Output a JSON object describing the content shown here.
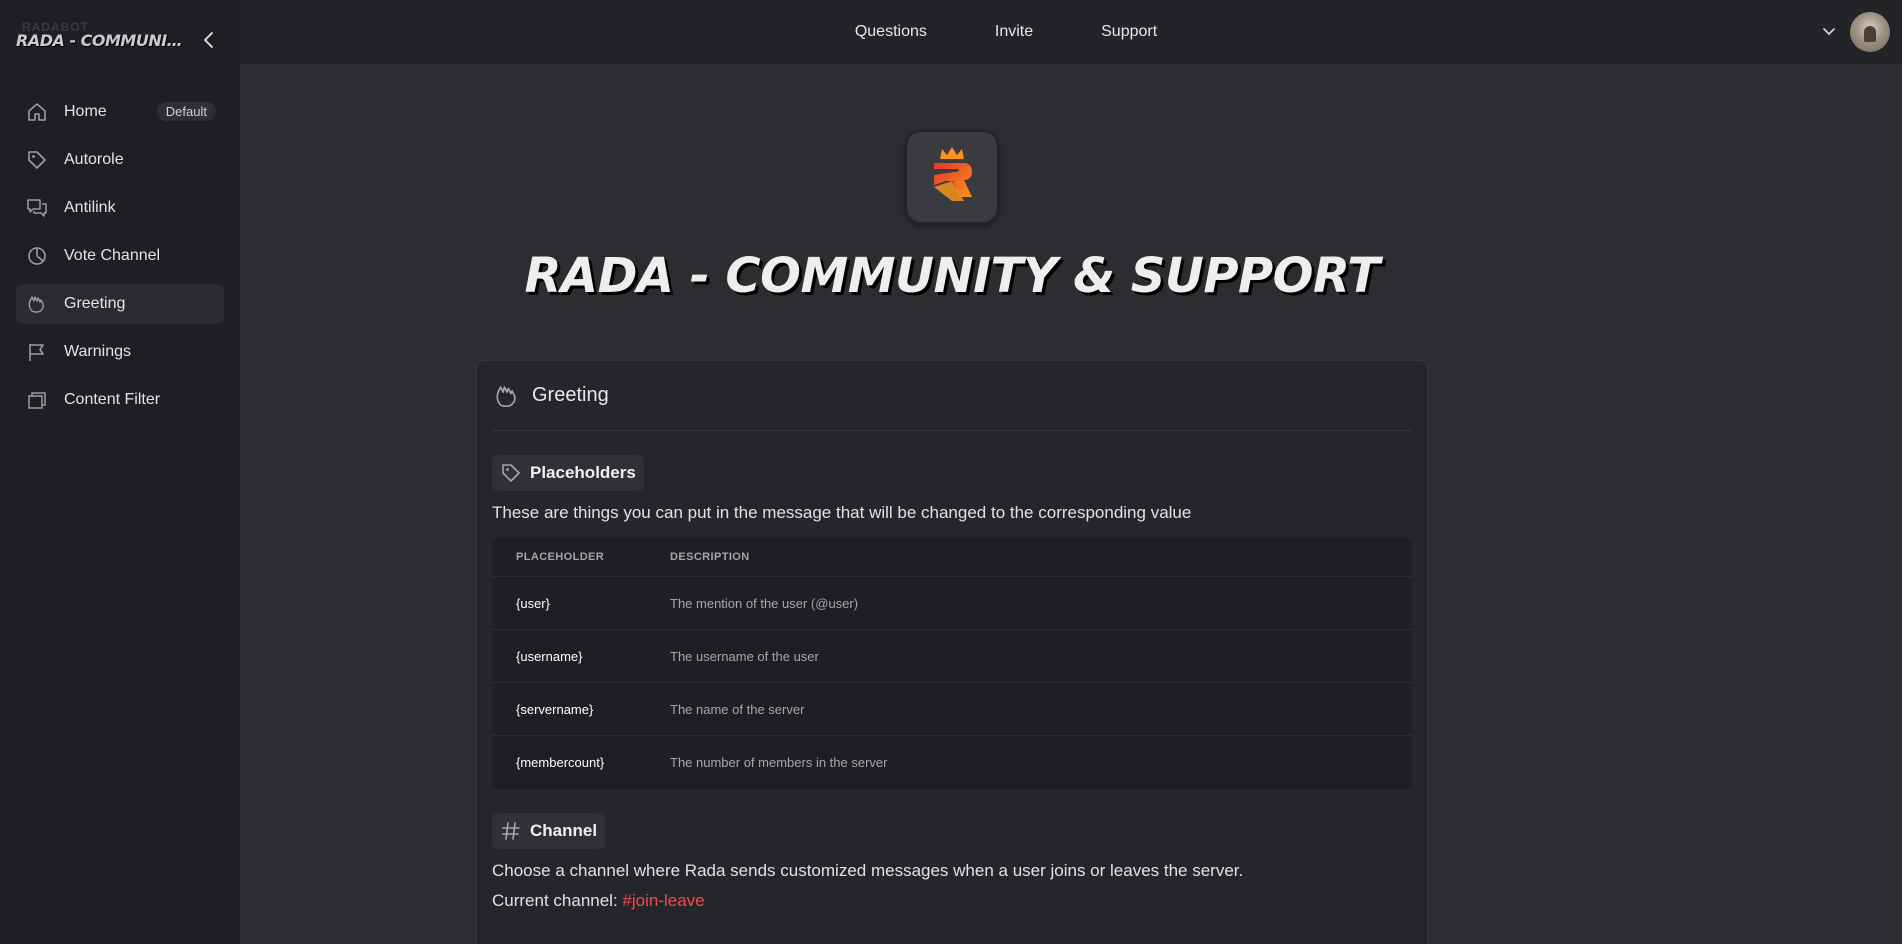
{
  "sidebar": {
    "brand_title": "RADA - COMMUNITY & SUPPORT",
    "brand_ghost": "RADABOT",
    "items": [
      {
        "label": "Home",
        "badge": "Default",
        "icon": "home-icon"
      },
      {
        "label": "Autorole",
        "icon": "tag-icon"
      },
      {
        "label": "Antilink",
        "icon": "chat-icon"
      },
      {
        "label": "Vote Channel",
        "icon": "pie-chart-icon"
      },
      {
        "label": "Greeting",
        "icon": "hand-wave-icon",
        "active": true
      },
      {
        "label": "Warnings",
        "icon": "flag-icon"
      },
      {
        "label": "Content Filter",
        "icon": "stack-icon"
      }
    ]
  },
  "topbar": {
    "links": [
      "Questions",
      "Invite",
      "Support"
    ]
  },
  "main": {
    "title": "RADA - COMMUNITY & SUPPORT",
    "card": {
      "title": "Greeting",
      "placeholders": {
        "heading": "Placeholders",
        "description": "These are things you can put in the message that will be changed to the corresponding value",
        "columns": [
          "PLACEHOLDER",
          "DESCRIPTION"
        ],
        "rows": [
          {
            "key": "{user}",
            "desc": "The mention of the user (@user)"
          },
          {
            "key": "{username}",
            "desc": "The username of the user"
          },
          {
            "key": "{servername}",
            "desc": "The name of the server"
          },
          {
            "key": "{membercount}",
            "desc": "The number of members in the server"
          }
        ]
      },
      "channel": {
        "heading": "Channel",
        "description": "Choose a channel where Rada sends customized messages when a user joins or leaves the server.",
        "current_label": "Current channel: ",
        "current_value": "#join-leave"
      }
    }
  },
  "colors": {
    "background": "#2c2d31",
    "sidebar": "#1e1f22",
    "channel_link": "#f04a4a",
    "logo_orange": "#f7931e",
    "logo_red": "#e8342a"
  }
}
